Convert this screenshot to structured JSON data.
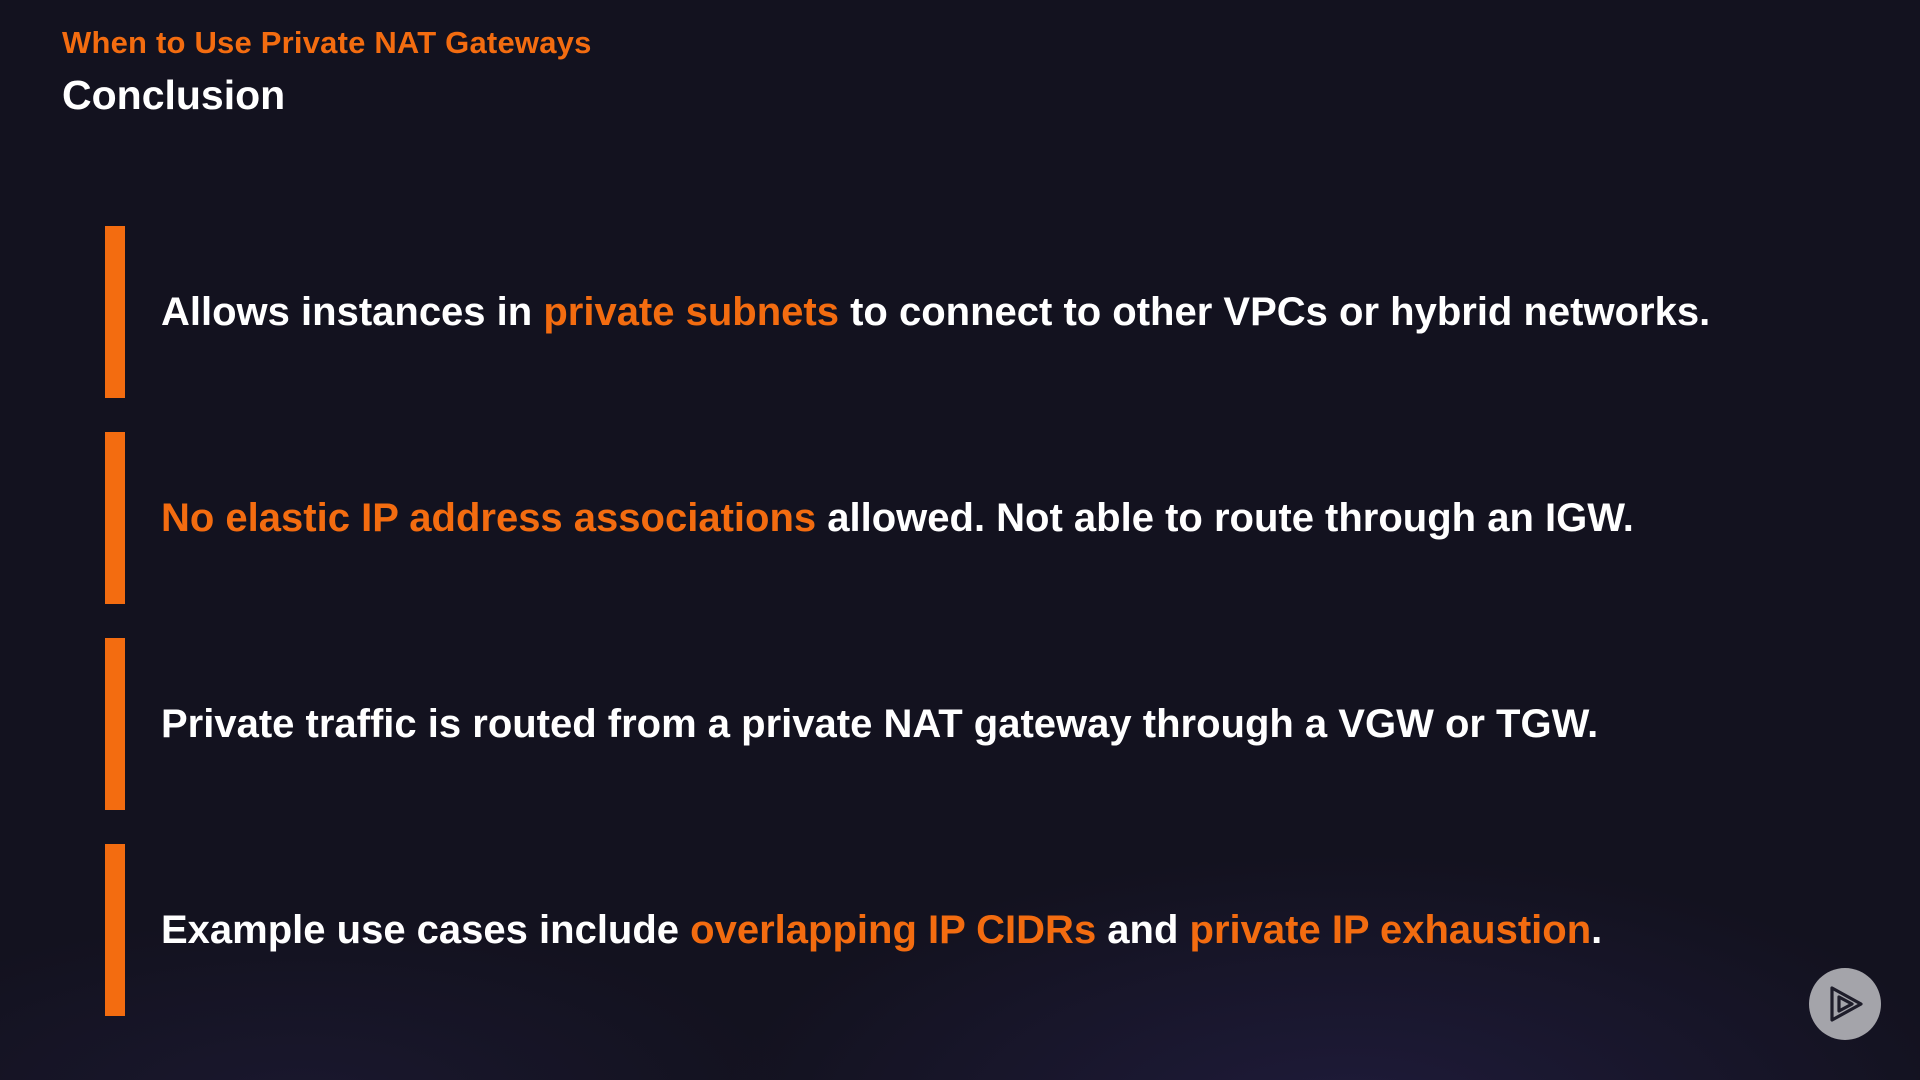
{
  "header": {
    "subtitle": "When to Use Private NAT Gateways",
    "title": "Conclusion"
  },
  "bullets": [
    {
      "segments": [
        {
          "text": "Allows instances in ",
          "highlight": false
        },
        {
          "text": "private subnets",
          "highlight": true
        },
        {
          "text": " to connect to other VPCs or hybrid networks.",
          "highlight": false
        }
      ]
    },
    {
      "segments": [
        {
          "text": "No elastic IP address associations",
          "highlight": true
        },
        {
          "text": " allowed. Not able to route through an IGW.",
          "highlight": false
        }
      ]
    },
    {
      "segments": [
        {
          "text": "Private traffic is routed from a private NAT gateway through a VGW or TGW.",
          "highlight": false
        }
      ]
    },
    {
      "segments": [
        {
          "text": "Example use cases include ",
          "highlight": false
        },
        {
          "text": "overlapping IP CIDRs",
          "highlight": true
        },
        {
          "text": " and ",
          "highlight": false
        },
        {
          "text": "private IP exhaustion",
          "highlight": true
        },
        {
          "text": ".",
          "highlight": false
        }
      ]
    }
  ],
  "colors": {
    "background": "#13121f",
    "accent": "#f36c10",
    "text": "#ffffff",
    "play_button": "#a4a4aa"
  },
  "icons": {
    "play_button": "play-icon"
  }
}
